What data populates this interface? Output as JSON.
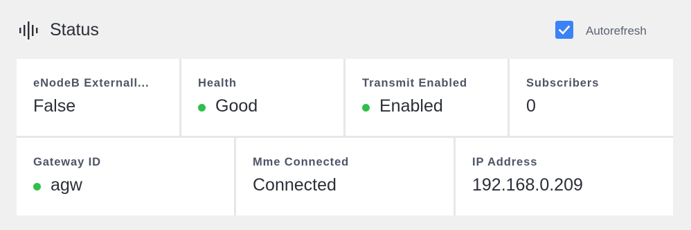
{
  "header": {
    "title": "Status",
    "icon": "audio-waveform-icon",
    "autorefresh": {
      "label": "Autorefresh",
      "checked": true,
      "color": "#3b82f6"
    }
  },
  "status_dot_color": "#2fbf4a",
  "row1": [
    {
      "label": "eNodeB Externall...",
      "value": "False",
      "indicator": false
    },
    {
      "label": "Health",
      "value": "Good",
      "indicator": true
    },
    {
      "label": "Transmit Enabled",
      "value": "Enabled",
      "indicator": true
    },
    {
      "label": "Subscribers",
      "value": "0",
      "indicator": false
    }
  ],
  "row2": [
    {
      "label": "Gateway ID",
      "value": "agw",
      "indicator": true
    },
    {
      "label": "Mme Connected",
      "value": "Connected",
      "indicator": false
    },
    {
      "label": "IP Address",
      "value": "192.168.0.209",
      "indicator": false
    }
  ]
}
